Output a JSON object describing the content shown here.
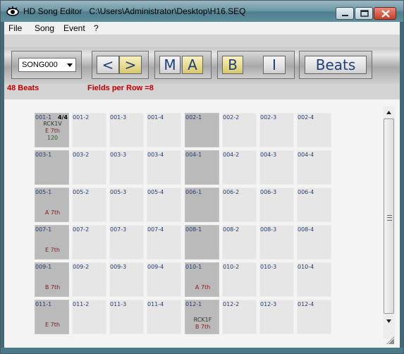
{
  "window": {
    "title": "HD Song Editor   C:\\Users\\Administrator\\Desktop\\H16.SEQ"
  },
  "menu": [
    "File",
    "Song",
    "Event",
    "?"
  ],
  "toolbar": {
    "song_select": "SONG000",
    "prev_label": "<",
    "next_label": ">",
    "m_label": "M",
    "a_label": "A",
    "b_label": "B",
    "i_label": "I",
    "beats_label": "Beats"
  },
  "status": {
    "beats": "48 Beats",
    "fields_per_row": "Fields per Row =8"
  },
  "colors": {
    "accent_text": "#1f3f77",
    "status_red": "#c00000",
    "cell_light": "#e6e6e6",
    "cell_dark": "#bababa"
  },
  "grid": {
    "rows": [
      [
        {
          "label": "001-1",
          "dark": true,
          "time_sig": "4/4",
          "lines": [
            {
              "t": "RCK1V",
              "c": "rhythm"
            },
            {
              "t": "E 7th",
              "c": "chord"
            },
            {
              "t": "120",
              "c": "tempo"
            }
          ]
        },
        {
          "label": "001-2"
        },
        {
          "label": "001-3"
        },
        {
          "label": "001-4"
        },
        {
          "label": "002-1",
          "dark": true
        },
        {
          "label": "002-2"
        },
        {
          "label": "002-3"
        },
        {
          "label": "002-4"
        }
      ],
      [
        {
          "label": "003-1",
          "dark": true
        },
        {
          "label": "003-2"
        },
        {
          "label": "003-3"
        },
        {
          "label": "003-4"
        },
        {
          "label": "004-1",
          "dark": true
        },
        {
          "label": "004-2"
        },
        {
          "label": "004-3"
        },
        {
          "label": "004-4"
        }
      ],
      [
        {
          "label": "005-1",
          "dark": true,
          "lines": [
            {
              "t": "A 7th",
              "c": "chord"
            }
          ]
        },
        {
          "label": "005-2"
        },
        {
          "label": "005-3"
        },
        {
          "label": "005-4"
        },
        {
          "label": "006-1",
          "dark": true
        },
        {
          "label": "006-2"
        },
        {
          "label": "006-3"
        },
        {
          "label": "006-4"
        }
      ],
      [
        {
          "label": "007-1",
          "dark": true,
          "lines": [
            {
              "t": "E 7th",
              "c": "chord"
            }
          ]
        },
        {
          "label": "007-2"
        },
        {
          "label": "007-3"
        },
        {
          "label": "007-4"
        },
        {
          "label": "008-1",
          "dark": true
        },
        {
          "label": "008-2"
        },
        {
          "label": "008-3"
        },
        {
          "label": "008-4"
        }
      ],
      [
        {
          "label": "009-1",
          "dark": true,
          "lines": [
            {
              "t": "B 7th",
              "c": "chord"
            }
          ]
        },
        {
          "label": "009-2"
        },
        {
          "label": "009-3"
        },
        {
          "label": "009-4"
        },
        {
          "label": "010-1",
          "dark": true,
          "lines": [
            {
              "t": "A 7th",
              "c": "chord"
            }
          ]
        },
        {
          "label": "010-2"
        },
        {
          "label": "010-3"
        },
        {
          "label": "010-4"
        }
      ],
      [
        {
          "label": "011-1",
          "dark": true,
          "lines": [
            {
              "t": "E 7th",
              "c": "chord"
            }
          ]
        },
        {
          "label": "011-2"
        },
        {
          "label": "011-3"
        },
        {
          "label": "011-4"
        },
        {
          "label": "012-1",
          "dark": true,
          "lines": [
            {
              "t": "RCK1F",
              "c": "rhythm"
            },
            {
              "t": "B 7th",
              "c": "chord"
            }
          ]
        },
        {
          "label": "012-2"
        },
        {
          "label": "012-3"
        },
        {
          "label": "012-4"
        }
      ]
    ]
  }
}
